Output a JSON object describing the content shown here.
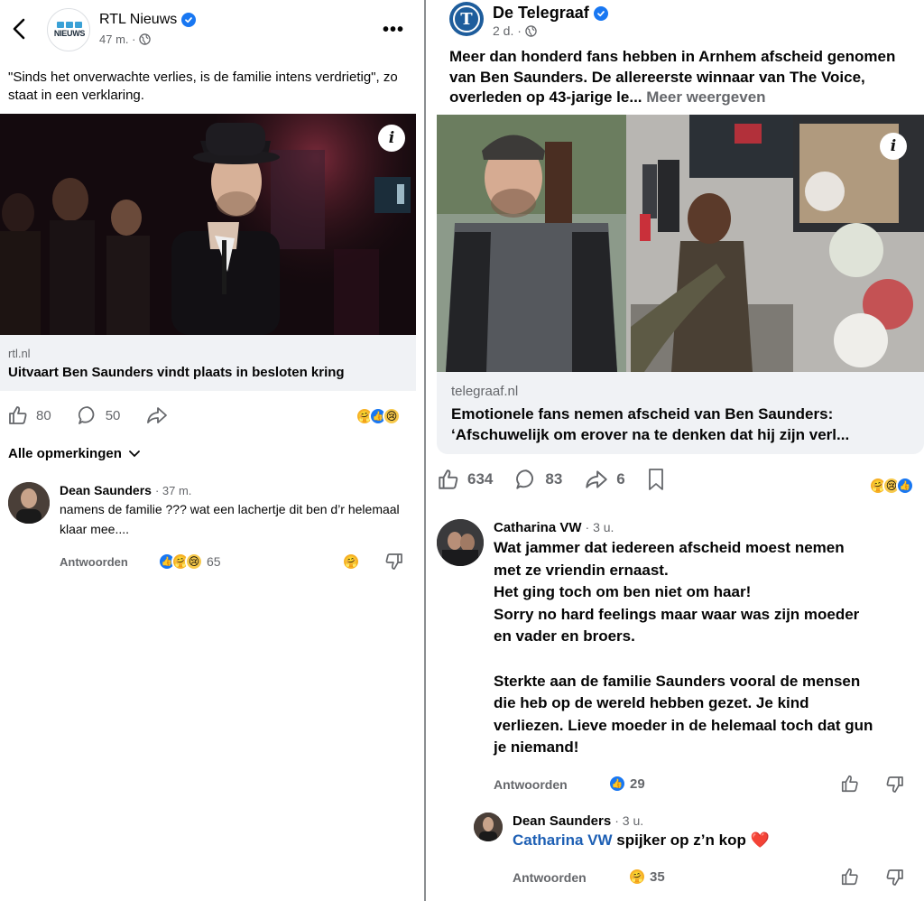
{
  "left": {
    "header": {
      "page_name": "RTL Nieuws",
      "avatar_text": "NIEUWS",
      "time": "47 m. ·"
    },
    "post_text": "\"Sinds het onverwachte verlies, is de familie intens verdrietig\", zo staat in een verklaring.",
    "link": {
      "domain": "rtl.nl",
      "title": "Uitvaart Ben Saunders vindt plaats in besloten kring"
    },
    "actions": {
      "likes": "80",
      "comments": "50"
    },
    "comments_filter": "Alle opmerkingen",
    "comment": {
      "author": "Dean Saunders",
      "time": "· 37 m.",
      "text": "namens de familie ??? wat een lachertje dit ben d’r helemaal klaar mee....",
      "reply_label": "Antwoorden",
      "reaction_count": "65"
    }
  },
  "right": {
    "header": {
      "page_name": "De Telegraaf",
      "avatar_letter": "T",
      "time": "2 d. ·"
    },
    "post_text": "Meer dan honderd fans hebben in Arnhem afscheid genomen van Ben Saunders. De allereerste winnaar van The Voice, overleden op 43-jarige le...",
    "see_more": "Meer weergeven",
    "link": {
      "domain": "telegraaf.nl",
      "title": "Emotionele fans nemen afscheid van Ben Saunders: ‘Afschuwelijk om erover na te denken dat hij zijn verl..."
    },
    "actions": {
      "likes": "634",
      "comments": "83",
      "shares": "6"
    },
    "comment": {
      "author": "Catharina VW",
      "time": "· 3 u.",
      "lines": [
        "Wat jammer dat iedereen afscheid moest nemen",
        "met ze vriendin ernaast.",
        "Het ging toch om ben niet om haar!",
        "Sorry no hard feelings maar waar was zijn moeder",
        "en vader en broers.",
        "",
        "Sterkte aan de familie Saunders vooral de mensen",
        "die heb op de wereld hebben gezet. Je kind",
        "verliezen. Lieve moeder in de helemaal toch dat gun",
        "je niemand!"
      ],
      "reply_label": "Antwoorden",
      "reaction_count": "29"
    },
    "reply": {
      "author": "Dean Saunders",
      "time": "· 3 u.",
      "mention": "Catharina VW",
      "text": " spijker op z’n kop ",
      "heart": "❤️",
      "reply_label": "Antwoorden",
      "reaction_count": "35"
    }
  },
  "colors": {
    "facebook_blue": "#1877f2",
    "secondary_text": "#65676b",
    "link_box_bg": "#f0f2f5",
    "heart": "#e0245e"
  }
}
